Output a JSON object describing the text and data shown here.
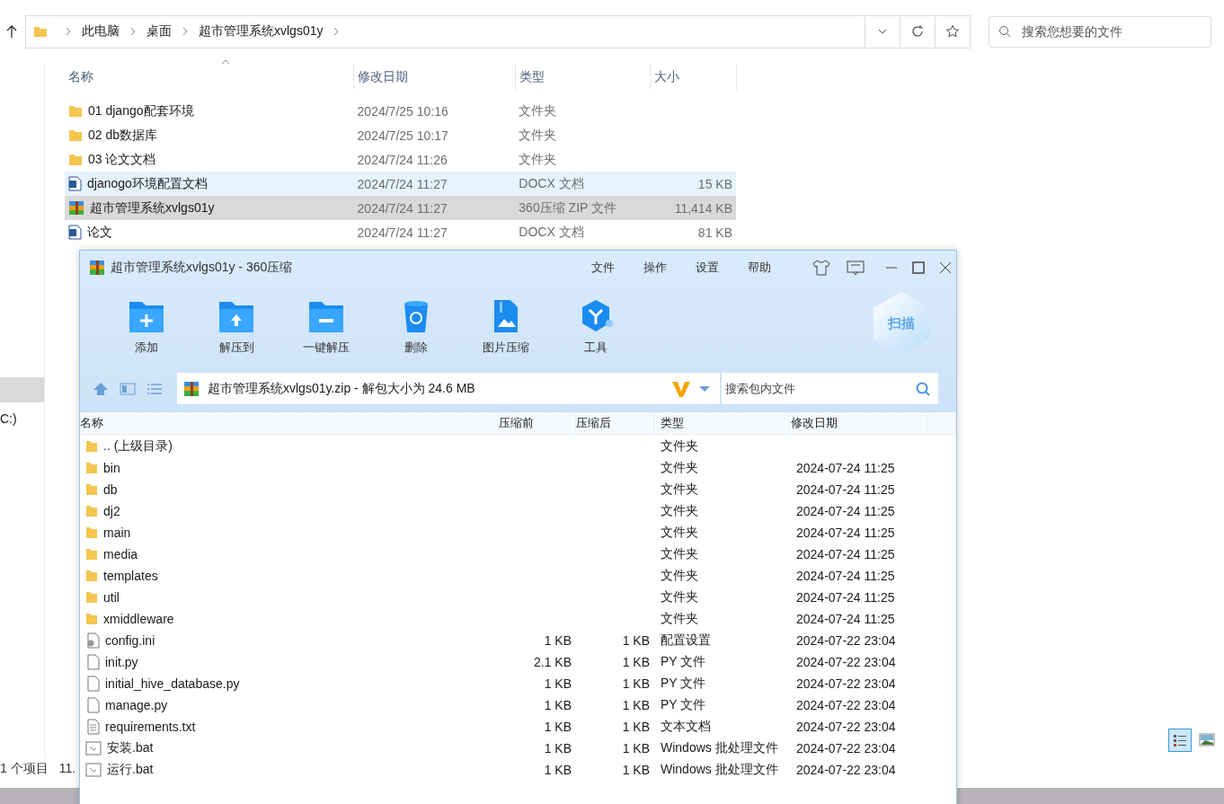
{
  "explorer": {
    "breadcrumbs": [
      "此电脑",
      "桌面",
      "超市管理系统xvlgs01y"
    ],
    "search": {
      "placeholder": "搜索您想要的文件"
    },
    "columns": [
      "名称",
      "修改日期",
      "类型",
      "大小"
    ],
    "files": [
      {
        "name": "01 django配套环境",
        "date": "2024/7/25 10:16",
        "type": "文件夹",
        "kind": "folder",
        "selected": false,
        "hovered": false
      },
      {
        "name": "02 db数据库",
        "date": "2024/7/25 10:17",
        "type": "文件夹",
        "kind": "folder",
        "selected": false,
        "hovered": false
      },
      {
        "name": "03 论文文档",
        "date": "2024/7/24 11:26",
        "type": "文件夹",
        "kind": "folder",
        "selected": false,
        "hovered": false
      },
      {
        "name": "djanogo环境配置文档",
        "date": "2024/7/24 11:27",
        "type": "DOCX 文档",
        "size": "15 KB",
        "kind": "word",
        "selected": false,
        "hovered": true
      },
      {
        "name": "超市管理系统xvlgs01y",
        "date": "2024/7/24 11:27",
        "type": "360压缩 ZIP 文件",
        "size": "11,414 KB",
        "kind": "zip",
        "selected": true,
        "hovered": false
      },
      {
        "name": "论文",
        "date": "2024/7/24 11:27",
        "type": "DOCX 文档",
        "size": "81 KB",
        "kind": "word",
        "selected": false,
        "hovered": false
      }
    ],
    "sidebar": [
      {
        "selected": true
      },
      {
        "label": "C:)",
        "selected": false
      }
    ],
    "status": {
      "count": "1 个项目",
      "size": "11."
    },
    "view_modes": [
      {
        "kind": "details",
        "selected": true
      },
      {
        "kind": "preview",
        "selected": false
      }
    ]
  },
  "zip_window": {
    "title": "超市管理系统xvlgs01y - 360压缩",
    "menu": [
      "文件",
      "操作",
      "设置",
      "帮助"
    ],
    "tools": [
      {
        "label": "添加",
        "kind": "add"
      },
      {
        "label": "解压到",
        "kind": "extract"
      },
      {
        "label": "一键解压",
        "kind": "quick"
      },
      {
        "label": "删除",
        "kind": "delete"
      },
      {
        "label": "图片压缩",
        "kind": "image"
      },
      {
        "label": "工具",
        "kind": "tools"
      }
    ],
    "scan_label": "扫描",
    "path": "超市管理系统xvlgs01y.zip - 解包大小为 24.6 MB",
    "search": {
      "placeholder": "搜索包内文件"
    },
    "columns": [
      "名称",
      "压缩前",
      "压缩后",
      "类型",
      "修改日期"
    ],
    "rows": [
      {
        "name": ".. (上级目录)",
        "type": "文件夹",
        "kind": "folder"
      },
      {
        "name": "bin",
        "type": "文件夹",
        "date": "2024-07-24 11:25",
        "kind": "folder"
      },
      {
        "name": "db",
        "type": "文件夹",
        "date": "2024-07-24 11:25",
        "kind": "folder"
      },
      {
        "name": "dj2",
        "type": "文件夹",
        "date": "2024-07-24 11:25",
        "kind": "folder"
      },
      {
        "name": "main",
        "type": "文件夹",
        "date": "2024-07-24 11:25",
        "kind": "folder"
      },
      {
        "name": "media",
        "type": "文件夹",
        "date": "2024-07-24 11:25",
        "kind": "folder"
      },
      {
        "name": "templates",
        "type": "文件夹",
        "date": "2024-07-24 11:25",
        "kind": "folder"
      },
      {
        "name": "util",
        "type": "文件夹",
        "date": "2024-07-24 11:25",
        "kind": "folder"
      },
      {
        "name": "xmiddleware",
        "type": "文件夹",
        "date": "2024-07-24 11:25",
        "kind": "folder"
      },
      {
        "name": "config.ini",
        "before": "1 KB",
        "after": "1 KB",
        "type": "配置设置",
        "date": "2024-07-22 23:04",
        "kind": "config"
      },
      {
        "name": "init.py",
        "before": "2.1 KB",
        "after": "1 KB",
        "type": "PY 文件",
        "date": "2024-07-22 23:04",
        "kind": "file"
      },
      {
        "name": "initial_hive_database.py",
        "before": "1 KB",
        "after": "1 KB",
        "type": "PY 文件",
        "date": "2024-07-22 23:04",
        "kind": "file"
      },
      {
        "name": "manage.py",
        "before": "1 KB",
        "after": "1 KB",
        "type": "PY 文件",
        "date": "2024-07-22 23:04",
        "kind": "file"
      },
      {
        "name": "requirements.txt",
        "before": "1 KB",
        "after": "1 KB",
        "type": "文本文档",
        "date": "2024-07-22 23:04",
        "kind": "text"
      },
      {
        "name": "安装.bat",
        "before": "1 KB",
        "after": "1 KB",
        "type": "Windows 批处理文件",
        "date": "2024-07-22 23:04",
        "kind": "bat"
      },
      {
        "name": "运行.bat",
        "before": "1 KB",
        "after": "1 KB",
        "type": "Windows 批处理文件",
        "date": "2024-07-22 23:04",
        "kind": "bat"
      }
    ]
  }
}
